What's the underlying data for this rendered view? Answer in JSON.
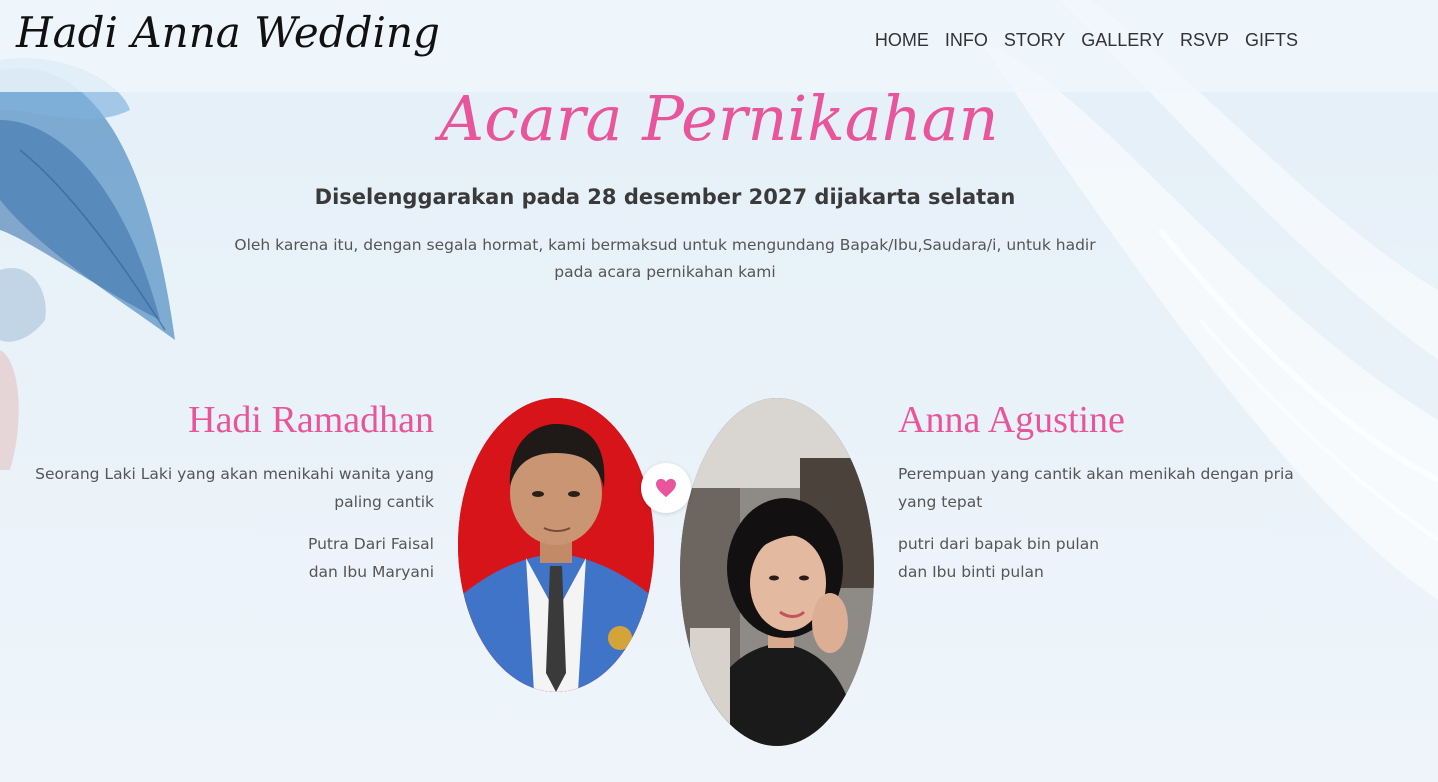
{
  "nav": {
    "brand": "Hadi Anna Wedding",
    "links": [
      "HOME",
      "INFO",
      "STORY",
      "GALLERY",
      "RSVP",
      "GIFTS"
    ]
  },
  "event": {
    "title": "Acara Pernikahan",
    "date_line": "Diselenggarakan pada 28 desember 2027 dijakarta selatan",
    "invite_line1": "Oleh karena itu, dengan segala hormat, kami bermaksud untuk mengundang Bapak/Ibu,Saudara/i, untuk hadir",
    "invite_line2": "pada acara pernikahan kami"
  },
  "groom": {
    "name": "Hadi Ramadhan",
    "desc_line1": "Seorang Laki Laki yang akan menikahi wanita yang",
    "desc_line2": "paling cantik",
    "parents_line1": "Putra Dari Faisal",
    "parents_line2": "dan Ibu Maryani"
  },
  "bride": {
    "name": "Anna Agustine",
    "desc_line1": "Perempuan yang cantik akan menikah dengan pria",
    "desc_line2": "yang tepat",
    "parents_line1": "putri dari bapak bin pulan",
    "parents_line2": "dan Ibu binti pulan"
  },
  "colors": {
    "accent": "#e8559b",
    "groom_photo_bg": "#d8141b",
    "text": "#555555"
  },
  "icons": {
    "heart": "heart-icon"
  }
}
